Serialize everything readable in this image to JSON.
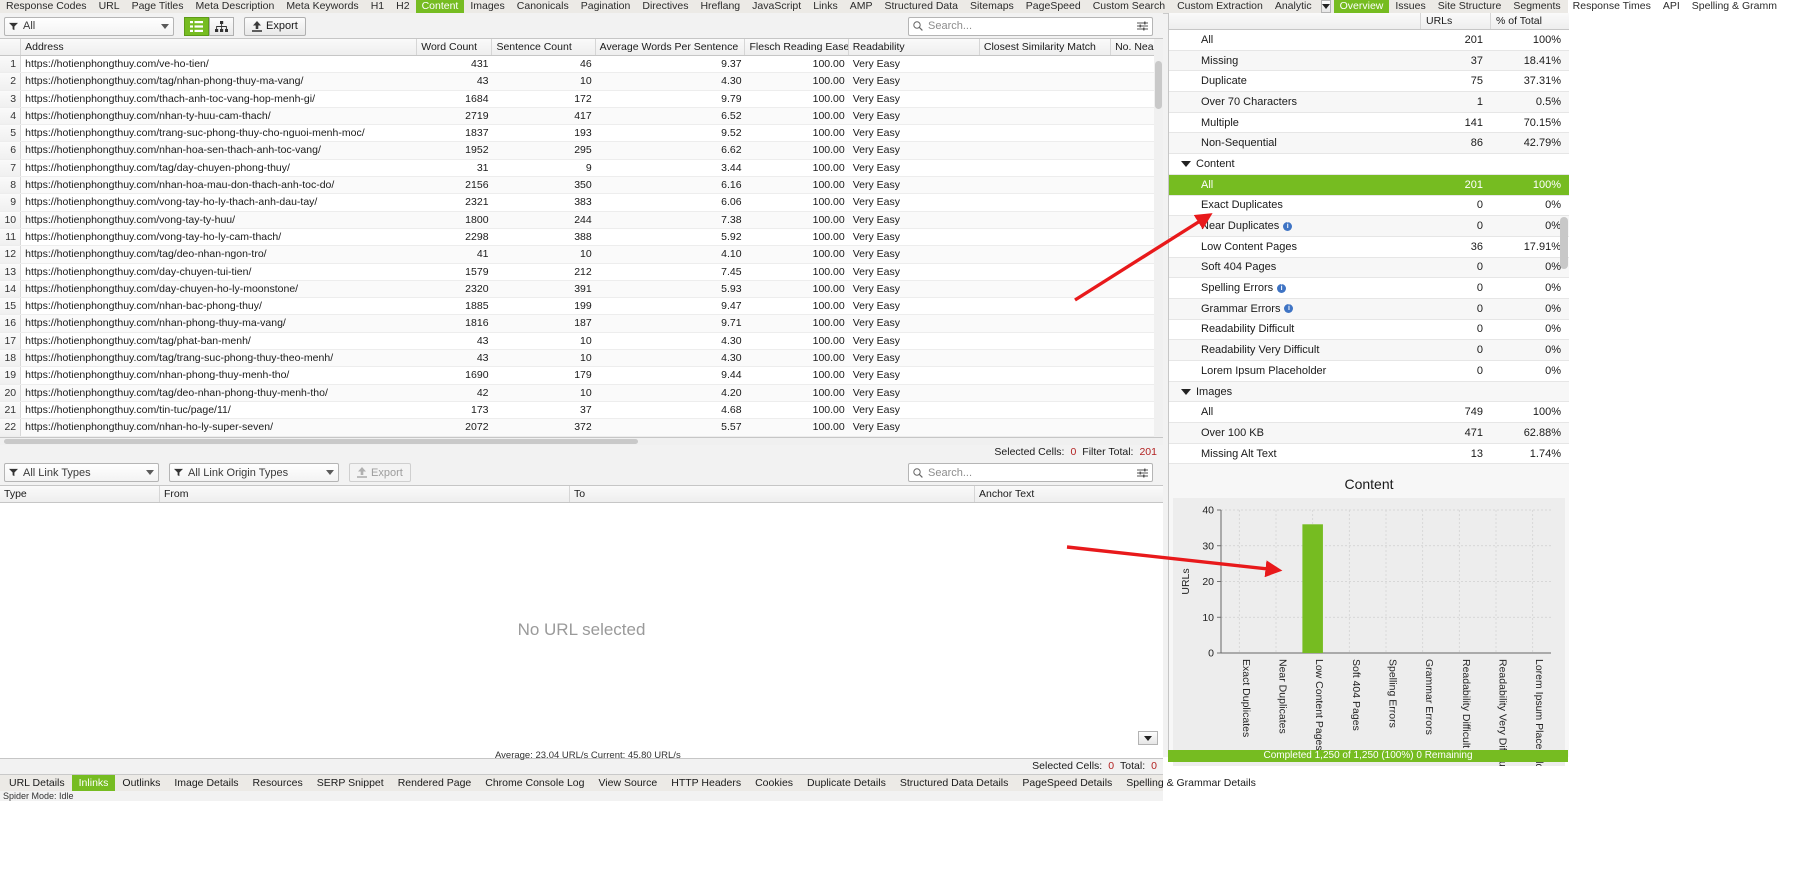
{
  "top_tabs": [
    {
      "label": "Response Codes",
      "selected": false
    },
    {
      "label": "URL",
      "selected": false
    },
    {
      "label": "Page Titles",
      "selected": false
    },
    {
      "label": "Meta Description",
      "selected": false
    },
    {
      "label": "Meta Keywords",
      "selected": false
    },
    {
      "label": "H1",
      "selected": false
    },
    {
      "label": "H2",
      "selected": false
    },
    {
      "label": "Content",
      "selected": true
    },
    {
      "label": "Images",
      "selected": false
    },
    {
      "label": "Canonicals",
      "selected": false
    },
    {
      "label": "Pagination",
      "selected": false
    },
    {
      "label": "Directives",
      "selected": false
    },
    {
      "label": "Hreflang",
      "selected": false
    },
    {
      "label": "JavaScript",
      "selected": false
    },
    {
      "label": "Links",
      "selected": false
    },
    {
      "label": "AMP",
      "selected": false
    },
    {
      "label": "Structured Data",
      "selected": false
    },
    {
      "label": "Sitemaps",
      "selected": false
    },
    {
      "label": "PageSpeed",
      "selected": false
    },
    {
      "label": "Custom Search",
      "selected": false
    },
    {
      "label": "Custom Extraction",
      "selected": false
    },
    {
      "label": "Analytic",
      "selected": false
    }
  ],
  "right_tabs": [
    {
      "label": "Overview",
      "selected": true
    },
    {
      "label": "Issues",
      "selected": false
    },
    {
      "label": "Site Structure",
      "selected": false
    },
    {
      "label": "Segments",
      "selected": false
    },
    {
      "label": "Response Times",
      "selected": false
    },
    {
      "label": "API",
      "selected": false
    },
    {
      "label": "Spelling & Gramm",
      "selected": false
    }
  ],
  "toolbar": {
    "filter_label": "All",
    "export_label": "Export",
    "search_placeholder": "Search..."
  },
  "table": {
    "columns": [
      "Address",
      "Word Count",
      "Sentence Count",
      "Average Words Per Sentence",
      "Flesch Reading Ease ...",
      "Readability",
      "Closest Similarity Match",
      "No. Near"
    ],
    "rows": [
      {
        "n": "1",
        "address": "https://hotienphongthuy.com/ve-ho-tien/",
        "wc": "431",
        "sc": "46",
        "aw": "9.37",
        "fre": "100.00",
        "rd": "Very Easy",
        "sim": "",
        "near": ""
      },
      {
        "n": "2",
        "address": "https://hotienphongthuy.com/tag/nhan-phong-thuy-ma-vang/",
        "wc": "43",
        "sc": "10",
        "aw": "4.30",
        "fre": "100.00",
        "rd": "Very Easy",
        "sim": "",
        "near": ""
      },
      {
        "n": "3",
        "address": "https://hotienphongthuy.com/thach-anh-toc-vang-hop-menh-gi/",
        "wc": "1684",
        "sc": "172",
        "aw": "9.79",
        "fre": "100.00",
        "rd": "Very Easy",
        "sim": "",
        "near": ""
      },
      {
        "n": "4",
        "address": "https://hotienphongthuy.com/nhan-ty-huu-cam-thach/",
        "wc": "2719",
        "sc": "417",
        "aw": "6.52",
        "fre": "100.00",
        "rd": "Very Easy",
        "sim": "",
        "near": ""
      },
      {
        "n": "5",
        "address": "https://hotienphongthuy.com/trang-suc-phong-thuy-cho-nguoi-menh-moc/",
        "wc": "1837",
        "sc": "193",
        "aw": "9.52",
        "fre": "100.00",
        "rd": "Very Easy",
        "sim": "",
        "near": ""
      },
      {
        "n": "6",
        "address": "https://hotienphongthuy.com/nhan-hoa-sen-thach-anh-toc-vang/",
        "wc": "1952",
        "sc": "295",
        "aw": "6.62",
        "fre": "100.00",
        "rd": "Very Easy",
        "sim": "",
        "near": ""
      },
      {
        "n": "7",
        "address": "https://hotienphongthuy.com/tag/day-chuyen-phong-thuy/",
        "wc": "31",
        "sc": "9",
        "aw": "3.44",
        "fre": "100.00",
        "rd": "Very Easy",
        "sim": "",
        "near": ""
      },
      {
        "n": "8",
        "address": "https://hotienphongthuy.com/nhan-hoa-mau-don-thach-anh-toc-do/",
        "wc": "2156",
        "sc": "350",
        "aw": "6.16",
        "fre": "100.00",
        "rd": "Very Easy",
        "sim": "",
        "near": ""
      },
      {
        "n": "9",
        "address": "https://hotienphongthuy.com/vong-tay-ho-ly-thach-anh-dau-tay/",
        "wc": "2321",
        "sc": "383",
        "aw": "6.06",
        "fre": "100.00",
        "rd": "Very Easy",
        "sim": "",
        "near": ""
      },
      {
        "n": "10",
        "address": "https://hotienphongthuy.com/vong-tay-ty-huu/",
        "wc": "1800",
        "sc": "244",
        "aw": "7.38",
        "fre": "100.00",
        "rd": "Very Easy",
        "sim": "",
        "near": ""
      },
      {
        "n": "11",
        "address": "https://hotienphongthuy.com/vong-tay-ho-ly-cam-thach/",
        "wc": "2298",
        "sc": "388",
        "aw": "5.92",
        "fre": "100.00",
        "rd": "Very Easy",
        "sim": "",
        "near": ""
      },
      {
        "n": "12",
        "address": "https://hotienphongthuy.com/tag/deo-nhan-ngon-tro/",
        "wc": "41",
        "sc": "10",
        "aw": "4.10",
        "fre": "100.00",
        "rd": "Very Easy",
        "sim": "",
        "near": ""
      },
      {
        "n": "13",
        "address": "https://hotienphongthuy.com/day-chuyen-tui-tien/",
        "wc": "1579",
        "sc": "212",
        "aw": "7.45",
        "fre": "100.00",
        "rd": "Very Easy",
        "sim": "",
        "near": ""
      },
      {
        "n": "14",
        "address": "https://hotienphongthuy.com/day-chuyen-ho-ly-moonstone/",
        "wc": "2320",
        "sc": "391",
        "aw": "5.93",
        "fre": "100.00",
        "rd": "Very Easy",
        "sim": "",
        "near": ""
      },
      {
        "n": "15",
        "address": "https://hotienphongthuy.com/nhan-bac-phong-thuy/",
        "wc": "1885",
        "sc": "199",
        "aw": "9.47",
        "fre": "100.00",
        "rd": "Very Easy",
        "sim": "",
        "near": ""
      },
      {
        "n": "16",
        "address": "https://hotienphongthuy.com/nhan-phong-thuy-ma-vang/",
        "wc": "1816",
        "sc": "187",
        "aw": "9.71",
        "fre": "100.00",
        "rd": "Very Easy",
        "sim": "",
        "near": ""
      },
      {
        "n": "17",
        "address": "https://hotienphongthuy.com/tag/phat-ban-menh/",
        "wc": "43",
        "sc": "10",
        "aw": "4.30",
        "fre": "100.00",
        "rd": "Very Easy",
        "sim": "",
        "near": ""
      },
      {
        "n": "18",
        "address": "https://hotienphongthuy.com/tag/trang-suc-phong-thuy-theo-menh/",
        "wc": "43",
        "sc": "10",
        "aw": "4.30",
        "fre": "100.00",
        "rd": "Very Easy",
        "sim": "",
        "near": ""
      },
      {
        "n": "19",
        "address": "https://hotienphongthuy.com/nhan-phong-thuy-menh-tho/",
        "wc": "1690",
        "sc": "179",
        "aw": "9.44",
        "fre": "100.00",
        "rd": "Very Easy",
        "sim": "",
        "near": ""
      },
      {
        "n": "20",
        "address": "https://hotienphongthuy.com/tag/deo-nhan-phong-thuy-menh-tho/",
        "wc": "42",
        "sc": "10",
        "aw": "4.20",
        "fre": "100.00",
        "rd": "Very Easy",
        "sim": "",
        "near": ""
      },
      {
        "n": "21",
        "address": "https://hotienphongthuy.com/tin-tuc/page/11/",
        "wc": "173",
        "sc": "37",
        "aw": "4.68",
        "fre": "100.00",
        "rd": "Very Easy",
        "sim": "",
        "near": ""
      },
      {
        "n": "22",
        "address": "https://hotienphongthuy.com/nhan-ho-ly-super-seven/",
        "wc": "2072",
        "sc": "372",
        "aw": "5.57",
        "fre": "100.00",
        "rd": "Very Easy",
        "sim": "",
        "near": ""
      }
    ],
    "status": {
      "selected_cells_label": "Selected Cells:",
      "selected_cells_value": "0",
      "filter_total_label": "Filter Total:",
      "filter_total_value": "201"
    }
  },
  "links_panel": {
    "link_types_label": "All Link Types",
    "link_origin_label": "All Link Origin Types",
    "export_label": "Export",
    "search_placeholder": "Search...",
    "columns": [
      "Type",
      "From",
      "To",
      "Anchor Text"
    ],
    "empty_message": "No URL selected",
    "status": {
      "selected_cells_label": "Selected Cells:",
      "selected_cells_value": "0",
      "total_label": "Total:",
      "total_value": "0"
    }
  },
  "bottom_tabs": [
    {
      "label": "URL Details",
      "selected": false
    },
    {
      "label": "Inlinks",
      "selected": true
    },
    {
      "label": "Outlinks",
      "selected": false
    },
    {
      "label": "Image Details",
      "selected": false
    },
    {
      "label": "Resources",
      "selected": false
    },
    {
      "label": "SERP Snippet",
      "selected": false
    },
    {
      "label": "Rendered Page",
      "selected": false
    },
    {
      "label": "Chrome Console Log",
      "selected": false
    },
    {
      "label": "View Source",
      "selected": false
    },
    {
      "label": "HTTP Headers",
      "selected": false
    },
    {
      "label": "Cookies",
      "selected": false
    },
    {
      "label": "Duplicate Details",
      "selected": false
    },
    {
      "label": "Structured Data Details",
      "selected": false
    },
    {
      "label": "PageSpeed Details",
      "selected": false
    },
    {
      "label": "Spelling & Grammar Details",
      "selected": false
    }
  ],
  "spider_status": "Spider Mode: Idle",
  "avg_status": "Average: 23.04 URL/s  Current: 45.80 URL/s",
  "completed_status": "Completed 1,250 of 1,250 (100%) 0 Remaining",
  "overview": {
    "col_urls": "URLs",
    "col_pct": "% of Total",
    "rows": [
      {
        "label": "All",
        "urls": "201",
        "pct": "100%",
        "type": "item",
        "selected": false
      },
      {
        "label": "Missing",
        "urls": "37",
        "pct": "18.41%",
        "type": "item",
        "selected": false
      },
      {
        "label": "Duplicate",
        "urls": "75",
        "pct": "37.31%",
        "type": "item",
        "selected": false
      },
      {
        "label": "Over 70 Characters",
        "urls": "1",
        "pct": "0.5%",
        "type": "item",
        "selected": false
      },
      {
        "label": "Multiple",
        "urls": "141",
        "pct": "70.15%",
        "type": "item",
        "selected": false
      },
      {
        "label": "Non-Sequential",
        "urls": "86",
        "pct": "42.79%",
        "type": "item",
        "selected": false
      },
      {
        "label": "Content",
        "urls": "",
        "pct": "",
        "type": "group",
        "selected": false
      },
      {
        "label": "All",
        "urls": "201",
        "pct": "100%",
        "type": "item",
        "selected": true
      },
      {
        "label": "Exact Duplicates",
        "urls": "0",
        "pct": "0%",
        "type": "item",
        "selected": false
      },
      {
        "label": "Near Duplicates",
        "urls": "0",
        "pct": "0%",
        "type": "item",
        "selected": false,
        "info": true
      },
      {
        "label": "Low Content Pages",
        "urls": "36",
        "pct": "17.91%",
        "type": "item",
        "selected": false
      },
      {
        "label": "Soft 404 Pages",
        "urls": "0",
        "pct": "0%",
        "type": "item",
        "selected": false
      },
      {
        "label": "Spelling Errors",
        "urls": "0",
        "pct": "0%",
        "type": "item",
        "selected": false,
        "info": true
      },
      {
        "label": "Grammar Errors",
        "urls": "0",
        "pct": "0%",
        "type": "item",
        "selected": false,
        "info": true
      },
      {
        "label": "Readability Difficult",
        "urls": "0",
        "pct": "0%",
        "type": "item",
        "selected": false
      },
      {
        "label": "Readability Very Difficult",
        "urls": "0",
        "pct": "0%",
        "type": "item",
        "selected": false
      },
      {
        "label": "Lorem Ipsum Placeholder",
        "urls": "0",
        "pct": "0%",
        "type": "item",
        "selected": false
      },
      {
        "label": "Images",
        "urls": "",
        "pct": "",
        "type": "group",
        "selected": false
      },
      {
        "label": "All",
        "urls": "749",
        "pct": "100%",
        "type": "item",
        "selected": false
      },
      {
        "label": "Over 100 KB",
        "urls": "471",
        "pct": "62.88%",
        "type": "item",
        "selected": false
      },
      {
        "label": "Missing Alt Text",
        "urls": "13",
        "pct": "1.74%",
        "type": "item",
        "selected": false
      }
    ]
  },
  "chart_data": {
    "type": "bar",
    "title": "Content",
    "xlabel": "",
    "ylabel": "URLs",
    "ylim": [
      0,
      40
    ],
    "yticks": [
      0,
      10,
      20,
      30,
      40
    ],
    "grid": true,
    "legend": "none",
    "bar_color": "#76bc21",
    "categories": [
      "Exact Duplicates",
      "Near Duplicates",
      "Low Content Pages",
      "Soft 404 Pages",
      "Spelling Errors",
      "Grammar Errors",
      "Readability Difficult",
      "Readability Very Difficult",
      "Lorem Ipsum Placeholder"
    ],
    "values": [
      0,
      0,
      36,
      0,
      0,
      0,
      0,
      0,
      0
    ]
  }
}
